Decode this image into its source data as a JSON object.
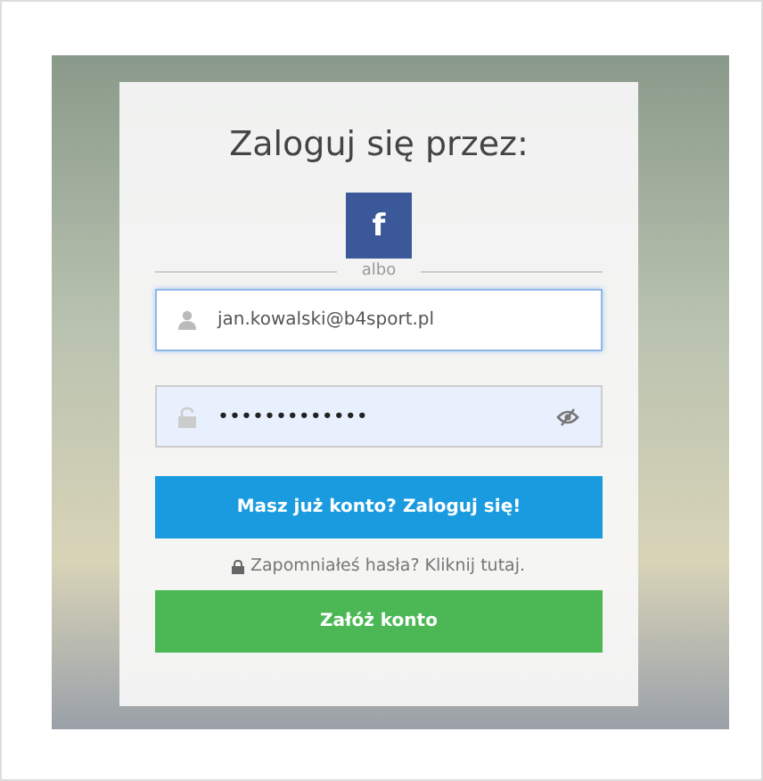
{
  "title": "Zaloguj się przez:",
  "facebook_button": {
    "glyph": "f"
  },
  "divider_text": "albo",
  "email_field": {
    "value": "jan.kowalski@b4sport.pl",
    "focused": true
  },
  "password_field": {
    "value": "•••••••••••••",
    "focused": false,
    "autofilled": true
  },
  "login_button": "Masz już konto? Zaloguj się!",
  "forgot_link": "Zapomniałeś hasła? Kliknij tutaj.",
  "register_button": "Załóż konto"
}
